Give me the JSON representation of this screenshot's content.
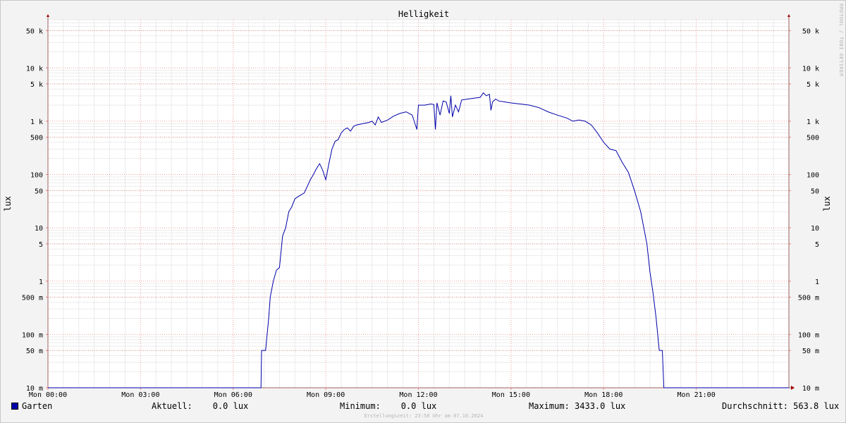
{
  "chart_data": {
    "type": "line",
    "title": "Helligkeit",
    "ylabel": "lux",
    "yscale": "log",
    "ylim": [
      0.01,
      80000
    ],
    "xlim": [
      0,
      24
    ],
    "grid": true,
    "x_ticks": [
      {
        "x": 0,
        "label": "Mon 00:00"
      },
      {
        "x": 3,
        "label": "Mon 03:00"
      },
      {
        "x": 6,
        "label": "Mon 06:00"
      },
      {
        "x": 9,
        "label": "Mon 09:00"
      },
      {
        "x": 12,
        "label": "Mon 12:00"
      },
      {
        "x": 15,
        "label": "Mon 15:00"
      },
      {
        "x": 18,
        "label": "Mon 18:00"
      },
      {
        "x": 21,
        "label": "Mon 21:00"
      }
    ],
    "y_ticks": [
      {
        "y": 50000,
        "label": "50 k"
      },
      {
        "y": 10000,
        "label": "10 k"
      },
      {
        "y": 5000,
        "label": "5 k"
      },
      {
        "y": 1000,
        "label": "1 k"
      },
      {
        "y": 500,
        "label": "500"
      },
      {
        "y": 100,
        "label": "100"
      },
      {
        "y": 50,
        "label": "50"
      },
      {
        "y": 10,
        "label": "10"
      },
      {
        "y": 5,
        "label": "5"
      },
      {
        "y": 1,
        "label": "1"
      },
      {
        "y": 0.5,
        "label": "500 m"
      },
      {
        "y": 0.1,
        "label": "100 m"
      },
      {
        "y": 0.05,
        "label": "50 m"
      },
      {
        "y": 0.01,
        "label": "10 m"
      }
    ],
    "series": [
      {
        "name": "Garten",
        "color": "#0000aa",
        "points": [
          [
            0,
            0.01
          ],
          [
            6.9,
            0.01
          ],
          [
            6.92,
            0.05
          ],
          [
            7.05,
            0.05
          ],
          [
            7.1,
            0.1
          ],
          [
            7.15,
            0.2
          ],
          [
            7.2,
            0.5
          ],
          [
            7.3,
            1.0
          ],
          [
            7.4,
            1.6
          ],
          [
            7.5,
            1.8
          ],
          [
            7.6,
            7
          ],
          [
            7.7,
            10
          ],
          [
            7.8,
            20
          ],
          [
            7.9,
            25
          ],
          [
            8.0,
            35
          ],
          [
            8.15,
            40
          ],
          [
            8.3,
            45
          ],
          [
            8.4,
            60
          ],
          [
            8.5,
            80
          ],
          [
            8.6,
            100
          ],
          [
            8.7,
            130
          ],
          [
            8.8,
            160
          ],
          [
            8.9,
            120
          ],
          [
            9.0,
            80
          ],
          [
            9.1,
            160
          ],
          [
            9.2,
            300
          ],
          [
            9.3,
            420
          ],
          [
            9.4,
            450
          ],
          [
            9.5,
            600
          ],
          [
            9.6,
            700
          ],
          [
            9.7,
            750
          ],
          [
            9.8,
            650
          ],
          [
            9.9,
            800
          ],
          [
            10.0,
            850
          ],
          [
            10.2,
            900
          ],
          [
            10.4,
            950
          ],
          [
            10.5,
            1000
          ],
          [
            10.6,
            850
          ],
          [
            10.7,
            1200
          ],
          [
            10.8,
            950
          ],
          [
            11.0,
            1050
          ],
          [
            11.2,
            1250
          ],
          [
            11.4,
            1400
          ],
          [
            11.6,
            1500
          ],
          [
            11.7,
            1400
          ],
          [
            11.8,
            1300
          ],
          [
            11.95,
            700
          ],
          [
            12.0,
            2000
          ],
          [
            12.2,
            2000
          ],
          [
            12.4,
            2100
          ],
          [
            12.5,
            2050
          ],
          [
            12.55,
            700
          ],
          [
            12.6,
            2200
          ],
          [
            12.7,
            1300
          ],
          [
            12.8,
            2400
          ],
          [
            12.9,
            2300
          ],
          [
            13.0,
            1400
          ],
          [
            13.05,
            3000
          ],
          [
            13.1,
            1200
          ],
          [
            13.2,
            2000
          ],
          [
            13.3,
            1500
          ],
          [
            13.4,
            2500
          ],
          [
            13.6,
            2600
          ],
          [
            13.8,
            2700
          ],
          [
            14.0,
            2800
          ],
          [
            14.1,
            3400
          ],
          [
            14.2,
            3000
          ],
          [
            14.3,
            3200
          ],
          [
            14.35,
            1600
          ],
          [
            14.4,
            2300
          ],
          [
            14.5,
            2600
          ],
          [
            14.6,
            2400
          ],
          [
            14.8,
            2300
          ],
          [
            15.0,
            2200
          ],
          [
            15.3,
            2100
          ],
          [
            15.6,
            2000
          ],
          [
            15.9,
            1800
          ],
          [
            16.2,
            1500
          ],
          [
            16.5,
            1300
          ],
          [
            16.8,
            1150
          ],
          [
            17.0,
            1000
          ],
          [
            17.2,
            1050
          ],
          [
            17.4,
            1000
          ],
          [
            17.6,
            850
          ],
          [
            17.8,
            600
          ],
          [
            18.0,
            400
          ],
          [
            18.2,
            300
          ],
          [
            18.4,
            280
          ],
          [
            18.6,
            170
          ],
          [
            18.8,
            110
          ],
          [
            19.0,
            50
          ],
          [
            19.2,
            20
          ],
          [
            19.4,
            5
          ],
          [
            19.5,
            1.5
          ],
          [
            19.6,
            0.6
          ],
          [
            19.7,
            0.2
          ],
          [
            19.8,
            0.05
          ],
          [
            19.9,
            0.05
          ],
          [
            19.95,
            0.01
          ],
          [
            24,
            0.01
          ]
        ]
      }
    ]
  },
  "legend": {
    "series_name": "Garten",
    "current": "Aktuell:    0.0 lux",
    "minimum": "Minimum:    0.0 lux",
    "maximum": "Maximum: 3433.0 lux",
    "average": "Durchschnitt: 563.8 lux"
  },
  "footer": "Erstellungszeit: 23:58 Uhr am 07.10.2024",
  "watermark": "RRDTOOL / TOBI OETIKER"
}
